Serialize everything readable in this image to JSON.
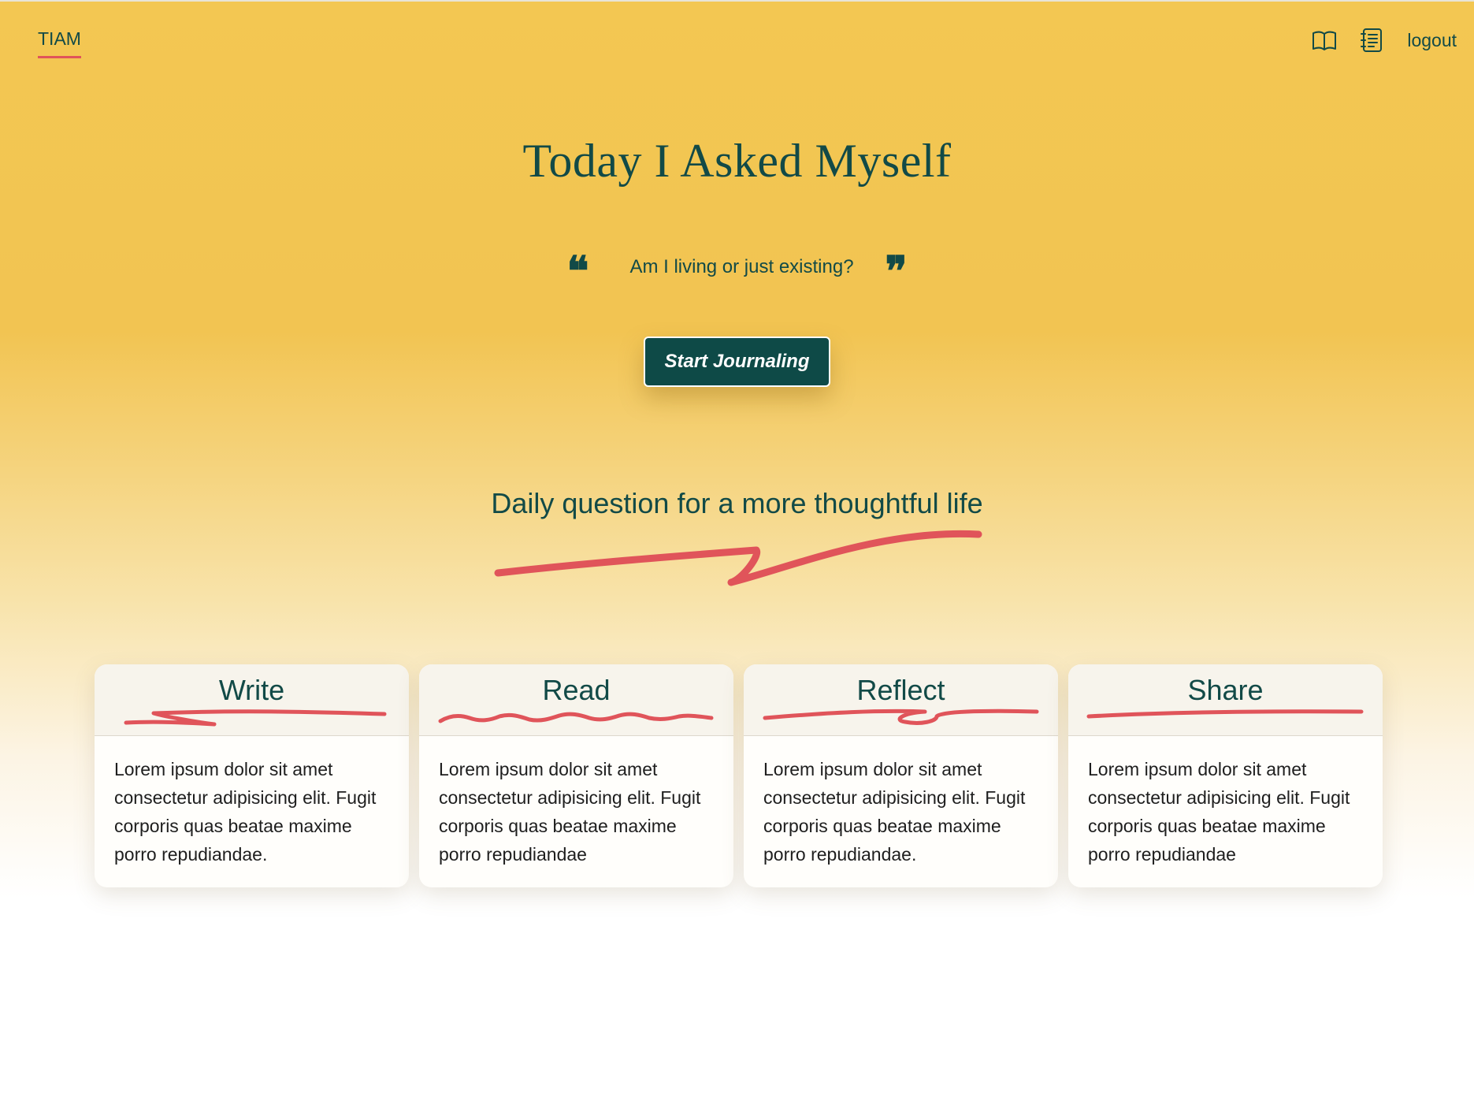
{
  "nav": {
    "brand": "TIAM",
    "icons": [
      "book-open-icon",
      "notebook-icon"
    ],
    "logout": "logout"
  },
  "hero": {
    "title": "Today I Asked Myself",
    "quote": "Am I living or just existing?",
    "open_quote": "❝",
    "close_quote": "❞",
    "cta": "Start Journaling",
    "tagline": "Daily question for a more thoughtful life"
  },
  "cards": [
    {
      "title": "Write",
      "body": "Lorem ipsum dolor sit amet consectetur adipisicing elit. Fugit corporis quas beatae maxime porro repudiandae."
    },
    {
      "title": "Read",
      "body": "Lorem ipsum dolor sit amet consectetur adipisicing elit. Fugit corporis quas beatae maxime porro repudiandae"
    },
    {
      "title": "Reflect",
      "body": "Lorem ipsum dolor sit amet consectetur adipisicing elit. Fugit corporis quas beatae maxime porro repudiandae."
    },
    {
      "title": "Share",
      "body": "Lorem ipsum dolor sit amet consectetur adipisicing elit. Fugit corporis quas beatae maxime porro repudiandae"
    }
  ],
  "colors": {
    "background_top": "#f3c752",
    "text": "#124a47",
    "accent": "#e0545a",
    "button": "#0e4a47"
  }
}
